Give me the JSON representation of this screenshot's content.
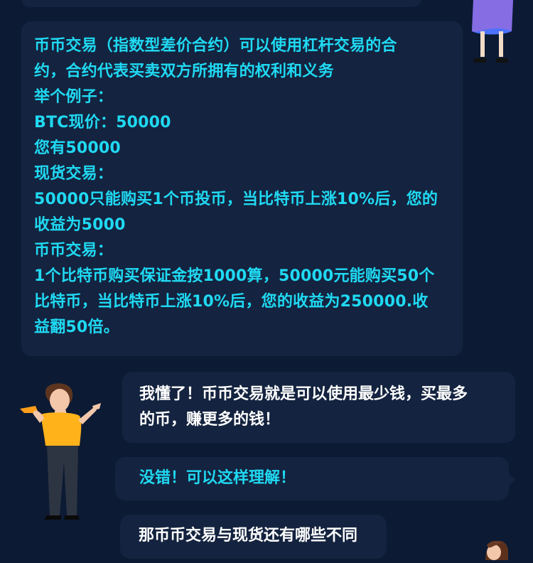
{
  "conversation": {
    "main_message_lines": [
      "币币交易（指数型差价合约）可以使用杠杆交易的合",
      "约，合约代表买卖双方所拥有的权利和义务",
      "举个例子：",
      "BTC现价：50000",
      "您有50000",
      "现货交易：",
      "50000只能购买1个币投币，当比特币上涨10%后，您的",
      "收益为5000",
      "币币交易：",
      "1个比特币购买保证金按1000算，50000元能购买50个",
      "比特币，当比特币上涨10%后，您的收益为250000.收",
      "益翻50倍。"
    ],
    "reply_1_lines": [
      "我懂了！币币交易就是可以使用最少钱，买最多",
      "的币，赚更多的钱！"
    ],
    "reply_2": "没错！可以这样理解！",
    "reply_3": "那币币交易与现货还有哪些不同"
  },
  "theme": {
    "background": "#0c1a34",
    "bubble": "#14233f",
    "accent_text": "#20d9f2",
    "primary_text": "#ffffff"
  },
  "illustrations": {
    "girl": "standing-girl-illustration",
    "man": "pointing-man-illustration",
    "bottom_person": "peeking-person-illustration"
  }
}
